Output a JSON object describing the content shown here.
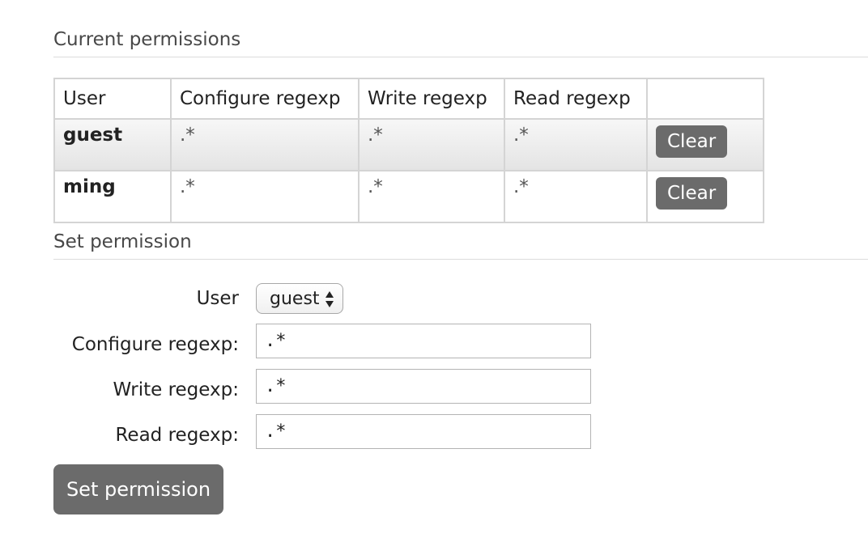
{
  "current_permissions": {
    "heading": "Current permissions",
    "columns": [
      "User",
      "Configure regexp",
      "Write regexp",
      "Read regexp",
      ""
    ],
    "rows": [
      {
        "user": "guest",
        "configure": ".*",
        "write": ".*",
        "read": ".*",
        "action": "Clear"
      },
      {
        "user": "ming",
        "configure": ".*",
        "write": ".*",
        "read": ".*",
        "action": "Clear"
      }
    ]
  },
  "set_permission": {
    "heading": "Set permission",
    "user_label": "User",
    "user_selected": "guest",
    "configure_label": "Configure regexp:",
    "configure_value": ".*",
    "write_label": "Write regexp:",
    "write_value": ".*",
    "read_label": "Read regexp:",
    "read_value": ".*",
    "submit_label": "Set permission"
  },
  "colors": {
    "button_bg": "#6b6b6b",
    "border": "#d4d4d4",
    "row_alt": "#ececec"
  }
}
